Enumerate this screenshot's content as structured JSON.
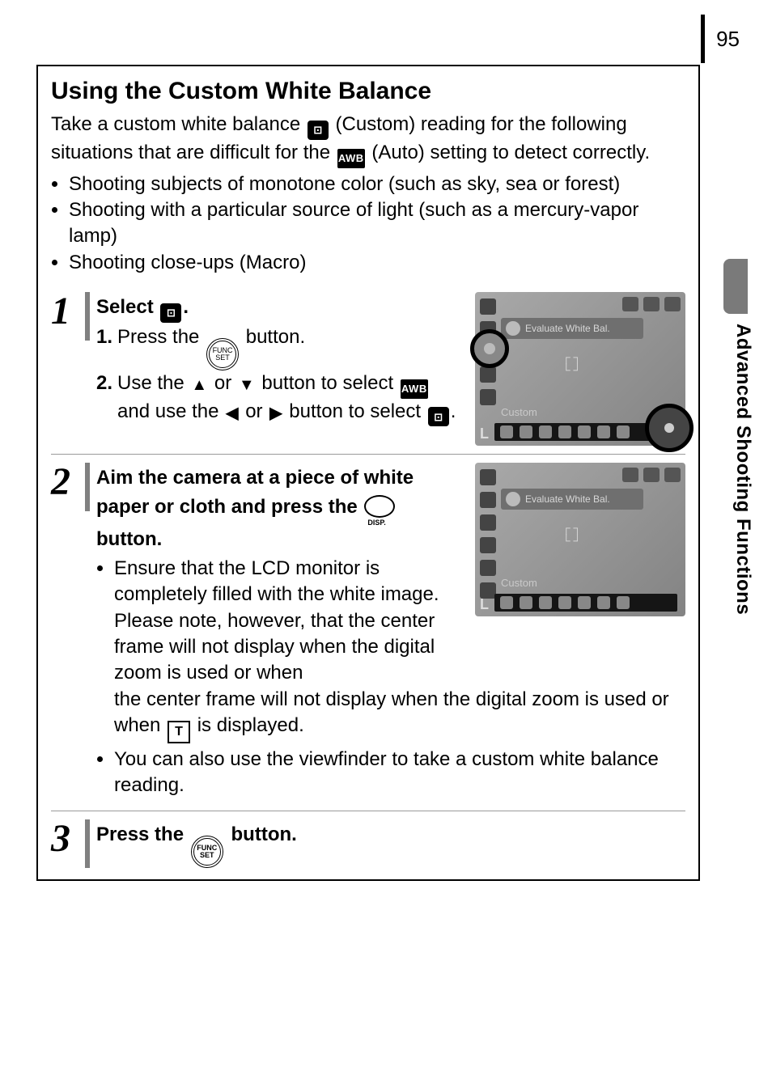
{
  "page_number": "95",
  "tab_label": "Advanced Shooting Functions",
  "heading": "Using the Custom White Balance",
  "intro_parts": {
    "a": "Take a custom white balance ",
    "b": " (Custom) reading for the following situations that are difficult for the ",
    "c": " (Auto) setting to detect correctly."
  },
  "bullets": [
    "Shooting subjects of monotone color (such as sky, sea or forest)",
    "Shooting with a particular source of light (such as a mercury-vapor lamp)",
    "Shooting close-ups (Macro)"
  ],
  "icons": {
    "custom_wb_icon": "⊡",
    "awb_text": "AWB",
    "funcset_top": "FUNC",
    "funcset_bottom": "SET",
    "disp_label": "DISP.",
    "arrow_up": "▲",
    "arrow_down": "▼",
    "arrow_left": "◀",
    "arrow_right": "▶",
    "T": "T"
  },
  "steps": {
    "s1": {
      "num": "1",
      "title_a": "Select ",
      "title_b": ".",
      "sub1_pre": "Press the ",
      "sub1_post": " button.",
      "sub2_a": "Use the ",
      "sub2_b": " or ",
      "sub2_c": " button to select ",
      "sub2_d": " and use the ",
      "sub2_e": " or ",
      "sub2_f": " button to select ",
      "sub2_g": "."
    },
    "s2": {
      "num": "2",
      "title_a": "Aim the camera at a piece of white paper or cloth and press the ",
      "title_b": " button.",
      "b1_a": "Ensure that the LCD monitor is completely filled with the white image. Please note, however, that the center frame will not display when the digital zoom is used or when ",
      "b1_b": " is displayed.",
      "b2": "You can also use the viewfinder to take a custom white balance reading."
    },
    "s3": {
      "num": "3",
      "title_a": "Press the ",
      "title_b": " button."
    }
  },
  "thumbs": {
    "t1": {
      "title": "Evaluate White Bal.",
      "caption": "Custom",
      "mid": "┌ ┐\n└ ┘"
    },
    "t2": {
      "title": "Evaluate White Bal.",
      "caption": "Custom",
      "mid": "┌ ┐\n└ ┘"
    }
  }
}
